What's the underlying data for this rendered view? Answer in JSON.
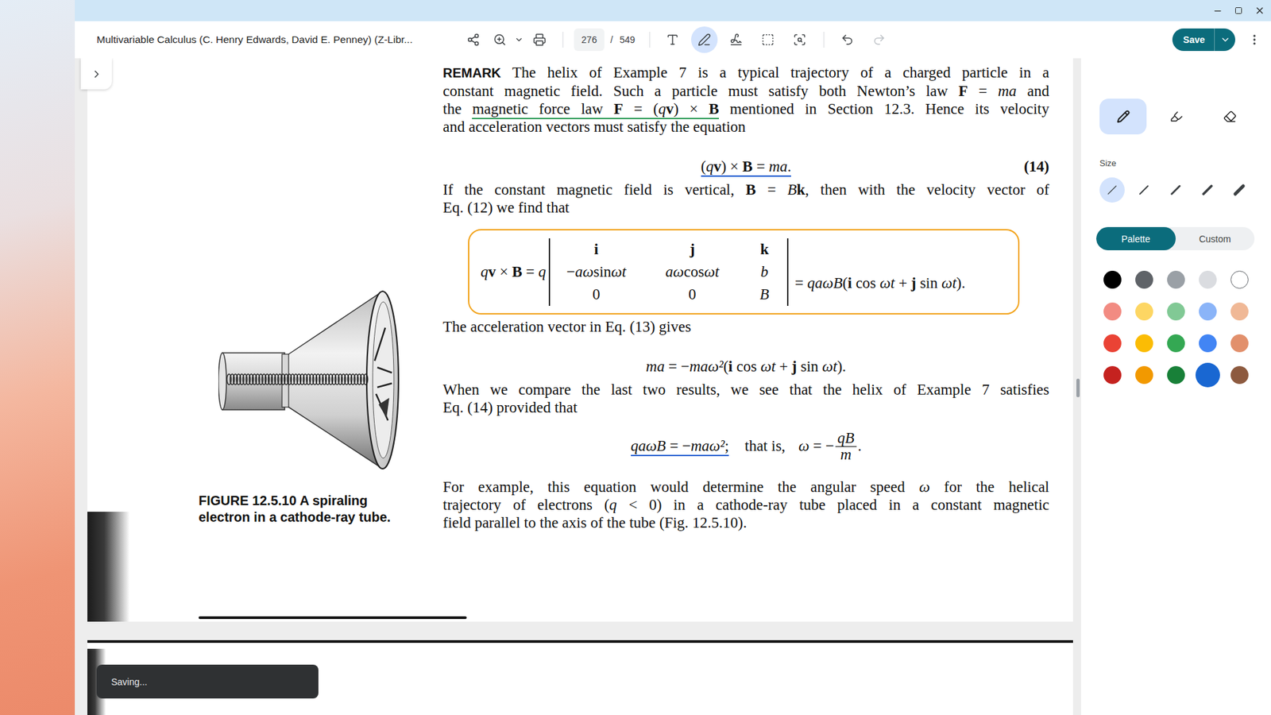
{
  "window": {
    "title": "Multivariable Calculus (C. Henry Edwards, David E. Penney) (Z-Libr..."
  },
  "toolbar": {
    "view_tools": [
      {
        "kind": "share"
      },
      {
        "kind": "zoom"
      },
      {
        "kind": "zoom-menu"
      },
      {
        "kind": "print"
      }
    ],
    "page": "276",
    "separator": "/",
    "total": "549",
    "annotate_tools": [
      {
        "kind": "text",
        "selected": false
      },
      {
        "kind": "pen",
        "selected": true
      },
      {
        "kind": "signature",
        "selected": false
      },
      {
        "kind": "select",
        "selected": false
      },
      {
        "kind": "scan",
        "selected": false
      }
    ],
    "history": [
      {
        "kind": "undo",
        "disabled": false
      },
      {
        "kind": "redo",
        "disabled": true
      }
    ],
    "save": "Save"
  },
  "document": {
    "blocks": [
      {
        "kind": "para",
        "lines": [
          [
            {
              "text": "REMARK",
              "kind": "label"
            },
            {
              "text": "  The helix of Example 7 is a typical trajectory of a charged particle in a"
            }
          ],
          [
            {
              "text": "constant magnetic field. Such a particle must satisfy both Newton’s law "
            },
            {
              "text": "F",
              "kind": "vec"
            },
            {
              "text": " = "
            },
            {
              "text": "ma",
              "kind": "math"
            },
            {
              "text": " and"
            }
          ],
          [
            {
              "text": "the "
            },
            {
              "kind": "mark",
              "color": "#2a9a55",
              "parts": [
                {
                  "text": "magnetic force law "
                },
                {
                  "text": "F",
                  "kind": "vec"
                },
                {
                  "text": " = ("
                },
                {
                  "text": "q",
                  "kind": "math"
                },
                {
                  "text": "v",
                  "kind": "vec"
                },
                {
                  "text": ") × "
                },
                {
                  "text": "B",
                  "kind": "vec"
                }
              ]
            },
            {
              "text": " mentioned in Section 12.3. Hence its velocity"
            }
          ],
          [
            {
              "text": "and acceleration vectors must satisfy the equation"
            }
          ]
        ]
      },
      {
        "kind": "equation",
        "number": "(14)",
        "parts": [
          {
            "kind": "mark",
            "color": "#1a5cd0",
            "parts": [
              {
                "text": "("
              },
              {
                "text": "q",
                "kind": "math"
              },
              {
                "text": "v",
                "kind": "vec"
              },
              {
                "text": ") × "
              },
              {
                "text": "B",
                "kind": "vec"
              },
              {
                "text": " = "
              },
              {
                "text": "ma",
                "kind": "math"
              },
              {
                "text": "."
              }
            ]
          }
        ]
      },
      {
        "kind": "para",
        "lines": [
          [
            {
              "text": "If the constant magnetic field is vertical, "
            },
            {
              "text": "B",
              "kind": "vec"
            },
            {
              "text": " = "
            },
            {
              "text": "B",
              "kind": "math"
            },
            {
              "text": "k",
              "kind": "vec"
            },
            {
              "text": ", then with the velocity vector of"
            }
          ],
          [
            {
              "text": "Eq. (12) we find that"
            }
          ]
        ]
      },
      {
        "kind": "determinant",
        "color": "#f2a31b",
        "left": [
          {
            "text": "q",
            "kind": "math"
          },
          {
            "text": "v",
            "kind": "vec"
          },
          {
            "text": " × "
          },
          {
            "text": "B",
            "kind": "vec"
          },
          {
            "text": " = "
          },
          {
            "text": "q",
            "kind": "math"
          }
        ],
        "rows": [
          [
            [
              {
                "text": "i",
                "kind": "vec"
              }
            ],
            [
              {
                "text": "j",
                "kind": "vec"
              }
            ],
            [
              {
                "text": "k",
                "kind": "vec"
              }
            ]
          ],
          [
            [
              {
                "text": "−"
              },
              {
                "text": "aω",
                "kind": "math"
              },
              {
                "text": " sin "
              },
              {
                "text": "ωt",
                "kind": "math"
              }
            ],
            [
              {
                "text": "aω",
                "kind": "math"
              },
              {
                "text": " cos "
              },
              {
                "text": "ωt",
                "kind": "math"
              }
            ],
            [
              {
                "text": "b",
                "kind": "math"
              }
            ]
          ],
          [
            [
              {
                "text": "0"
              }
            ],
            [
              {
                "text": "0"
              }
            ],
            [
              {
                "text": "B",
                "kind": "math"
              }
            ]
          ]
        ],
        "right": [
          {
            "text": "= "
          },
          {
            "text": "qaωB",
            "kind": "math"
          },
          {
            "text": "("
          },
          {
            "text": "i",
            "kind": "vec"
          },
          {
            "text": " cos "
          },
          {
            "text": "ωt",
            "kind": "math"
          },
          {
            "text": " + "
          },
          {
            "text": "j",
            "kind": "vec"
          },
          {
            "text": " sin "
          },
          {
            "text": "ωt",
            "kind": "math"
          },
          {
            "text": ")."
          }
        ]
      },
      {
        "kind": "para",
        "lines": [
          [
            {
              "text": "The acceleration vector in Eq. (13) gives"
            }
          ]
        ]
      },
      {
        "kind": "equation",
        "parts": [
          {
            "text": "ma",
            "kind": "math"
          },
          {
            "text": " = −"
          },
          {
            "text": "maω²",
            "kind": "math"
          },
          {
            "text": "("
          },
          {
            "text": "i",
            "kind": "vec"
          },
          {
            "text": " cos "
          },
          {
            "text": "ωt",
            "kind": "math"
          },
          {
            "text": " + "
          },
          {
            "text": "j",
            "kind": "vec"
          },
          {
            "text": " sin "
          },
          {
            "text": "ωt",
            "kind": "math"
          },
          {
            "text": ")."
          }
        ]
      },
      {
        "kind": "para",
        "lines": [
          [
            {
              "text": "When we compare the last two results, we see that the helix of Example 7 satisfies"
            }
          ],
          [
            {
              "text": "Eq. (14) provided that"
            }
          ]
        ]
      },
      {
        "kind": "solution",
        "parts": [
          {
            "kind": "mark",
            "color": "#1a5cd0",
            "parts": [
              {
                "text": "qaωB",
                "kind": "math"
              },
              {
                "text": " = −"
              },
              {
                "text": "maω²",
                "kind": "math"
              },
              {
                "text": ";"
              }
            ]
          }
        ],
        "middle": "that is,",
        "lhs": [
          {
            "text": "ω",
            "kind": "math"
          },
          {
            "text": " = −"
          }
        ],
        "numerator": [
          {
            "text": "qB",
            "kind": "math"
          }
        ],
        "denominator": [
          {
            "text": "m",
            "kind": "math"
          }
        ],
        "end": "."
      },
      {
        "kind": "para",
        "lines": [
          [
            {
              "text": "For example, this equation would determine the angular speed "
            },
            {
              "text": "ω",
              "kind": "math"
            },
            {
              "text": " for the helical"
            }
          ],
          [
            {
              "text": "trajectory of electrons ("
            },
            {
              "text": "q",
              "kind": "math"
            },
            {
              "text": " < 0) in a cathode-ray tube placed in a constant magnetic"
            }
          ],
          [
            {
              "text": "field parallel to the axis of the tube (Fig. 12.5.10)."
            }
          ]
        ]
      }
    ],
    "caption": {
      "label": "FIGURE 12.5.10",
      "lines": [
        "A spiraling",
        "electron in a cathode-ray tube."
      ]
    }
  },
  "panel": {
    "tools": [
      {
        "kind": "pen",
        "selected": true
      },
      {
        "kind": "highlighter",
        "selected": false
      },
      {
        "kind": "eraser",
        "selected": false
      }
    ],
    "size_label": "Size",
    "sizes": [
      {
        "selected": true
      },
      {
        "selected": false
      },
      {
        "selected": false
      },
      {
        "selected": false
      },
      {
        "selected": false
      }
    ],
    "modes": [
      {
        "label": "Palette",
        "selected": true
      },
      {
        "label": "Custom",
        "selected": false
      }
    ],
    "colors": [
      {
        "color": "#000000",
        "selected": false
      },
      {
        "color": "#5f6368",
        "selected": false
      },
      {
        "color": "#9aa0a6",
        "selected": false
      },
      {
        "color": "#dadce0",
        "selected": false
      },
      {
        "color": "#ffffff",
        "selected": false
      },
      {
        "color": "#f28b82",
        "selected": false
      },
      {
        "color": "#fdd663",
        "selected": false
      },
      {
        "color": "#81c995",
        "selected": false
      },
      {
        "color": "#8ab4f8",
        "selected": false
      },
      {
        "color": "#f0b896",
        "selected": false
      },
      {
        "color": "#ea4335",
        "selected": false
      },
      {
        "color": "#fbbc04",
        "selected": false
      },
      {
        "color": "#34a853",
        "selected": false
      },
      {
        "color": "#4285f4",
        "selected": false
      },
      {
        "color": "#e2906c",
        "selected": false
      },
      {
        "color": "#c5221f",
        "selected": false
      },
      {
        "color": "#f29900",
        "selected": false
      },
      {
        "color": "#188038",
        "selected": false
      },
      {
        "color": "#1967d2",
        "selected": true
      },
      {
        "color": "#8d5a3f",
        "selected": false
      }
    ]
  },
  "toast": {
    "text": "Saving..."
  }
}
